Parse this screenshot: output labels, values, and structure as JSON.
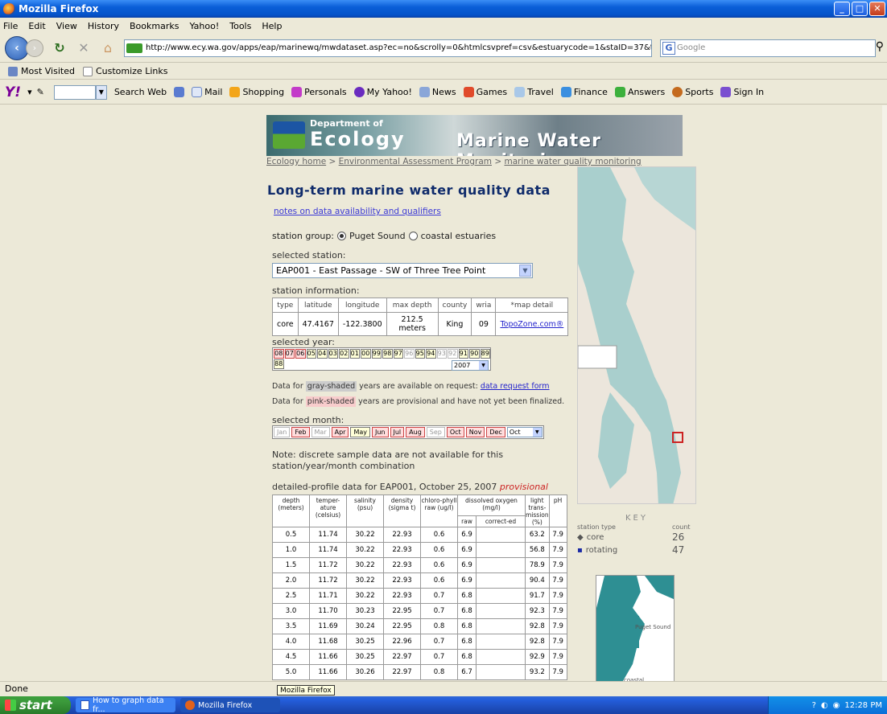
{
  "window": {
    "title": "Mozilla Firefox"
  },
  "menu": [
    "File",
    "Edit",
    "View",
    "History",
    "Bookmarks",
    "Yahoo!",
    "Tools",
    "Help"
  ],
  "nav": {
    "url": "http://www.ecy.wa.gov/apps/eap/marinewq/mwdataset.asp?ec=no&scrolly=0&htmlcsvpref=csv&estuarycode=1&staID=37&theyear=2007&themon",
    "search_placeholder": "Google"
  },
  "bookmarks": [
    "Most Visited",
    "Customize Links"
  ],
  "yahoo_bar": {
    "logo": "Y!",
    "items": [
      "Search Web",
      "Mail",
      "Shopping",
      "Personals",
      "My Yahoo!",
      "News",
      "Games",
      "Travel",
      "Finance",
      "Answers",
      "Sports",
      "Sign In"
    ]
  },
  "page": {
    "banner": {
      "dept": "Department of",
      "ecology": "Ecology",
      "subtitle": "Marine Water Monitoring"
    },
    "breadcrumb": [
      "Ecology home",
      "Environmental Assessment Program",
      "marine water quality monitoring"
    ],
    "heading": "Long-term marine water quality data",
    "notes_link": "notes on data availability and qualifiers",
    "station_group": {
      "label": "station group:",
      "options": [
        "Puget Sound",
        "coastal estuaries"
      ]
    },
    "selected_station_label": "selected station:",
    "selected_station": "EAP001 - East Passage - SW of Three Tree Point",
    "station_info_label": "station information:",
    "station_info": {
      "headers": [
        "type",
        "latitude",
        "longitude",
        "max depth",
        "county",
        "wria",
        "*map detail"
      ],
      "values": [
        "core",
        "47.4167",
        "-122.3800",
        "212.5 meters",
        "King",
        "09",
        "TopoZone.com®"
      ]
    },
    "selected_year_label": "selected year:",
    "years_row1": [
      "08",
      "07",
      "06",
      "05",
      "04",
      "03",
      "02",
      "01",
      "00",
      "99",
      "98",
      "97",
      "96",
      "95",
      "94",
      "93",
      "92",
      "91",
      "90",
      "89"
    ],
    "years_row2": [
      "88"
    ],
    "year_select": "2007",
    "gray_note": {
      "pre": "Data for",
      "shade": "gray-shaded",
      "post": "years are available on request:",
      "link": "data request form"
    },
    "pink_note": {
      "pre": "Data for",
      "shade": "pink-shaded",
      "post": "years are provisional and have not yet been finalized."
    },
    "selected_month_label": "selected month:",
    "months": [
      "Jan",
      "Feb",
      "Mar",
      "Apr",
      "May",
      "Jun",
      "Jul",
      "Aug",
      "Sep",
      "Oct",
      "Nov",
      "Dec"
    ],
    "month_select": "Oct",
    "discrete_note": "Note: discrete sample data are not available for this station/year/month combination",
    "profile_title": "detailed-profile data for EAP001, October 25, 2007",
    "profile_status": "provisional",
    "profile": {
      "headers": [
        "depth (meters)",
        "temper-ature (celsius)",
        "salinity (psu)",
        "density (sigma t)",
        "chloro-phyll raw (ug/l)",
        "dissolved oxygen (mg/l)",
        "light trans-mission (%)",
        "pH"
      ],
      "sub_headers": [
        "raw",
        "correct-ed"
      ],
      "rows": [
        [
          "0.5",
          "11.74",
          "30.22",
          "22.93",
          "0.6",
          "6.9",
          "",
          "63.2",
          "7.9"
        ],
        [
          "1.0",
          "11.74",
          "30.22",
          "22.93",
          "0.6",
          "6.9",
          "",
          "56.8",
          "7.9"
        ],
        [
          "1.5",
          "11.72",
          "30.22",
          "22.93",
          "0.6",
          "6.9",
          "",
          "78.9",
          "7.9"
        ],
        [
          "2.0",
          "11.72",
          "30.22",
          "22.93",
          "0.6",
          "6.9",
          "",
          "90.4",
          "7.9"
        ],
        [
          "2.5",
          "11.71",
          "30.22",
          "22.93",
          "0.7",
          "6.8",
          "",
          "91.7",
          "7.9"
        ],
        [
          "3.0",
          "11.70",
          "30.23",
          "22.95",
          "0.7",
          "6.8",
          "",
          "92.3",
          "7.9"
        ],
        [
          "3.5",
          "11.69",
          "30.24",
          "22.95",
          "0.8",
          "6.8",
          "",
          "92.8",
          "7.9"
        ],
        [
          "4.0",
          "11.68",
          "30.25",
          "22.96",
          "0.7",
          "6.8",
          "",
          "92.8",
          "7.9"
        ],
        [
          "4.5",
          "11.66",
          "30.25",
          "22.97",
          "0.7",
          "6.8",
          "",
          "92.9",
          "7.9"
        ],
        [
          "5.0",
          "11.66",
          "30.26",
          "22.97",
          "0.8",
          "6.7",
          "",
          "93.2",
          "7.9"
        ]
      ]
    },
    "key": {
      "title": "KEY",
      "col1": "station type",
      "col2": "count",
      "rows": [
        {
          "label": "core",
          "count": "26"
        },
        {
          "label": "rotating",
          "count": "47"
        }
      ]
    },
    "inset_labels": [
      "Puget Sound",
      "coastal"
    ]
  },
  "status": "Done",
  "tooltip": "Mozilla Firefox",
  "taskbar": {
    "start": "start",
    "tasks": [
      "How to graph data fr...",
      "Mozilla Firefox"
    ],
    "clock": "12:28 PM"
  },
  "colors": {
    "heading": "#0f2b6b",
    "provisional": "#cc2222",
    "pink": "#ffdddd",
    "link": "#2222cc"
  }
}
